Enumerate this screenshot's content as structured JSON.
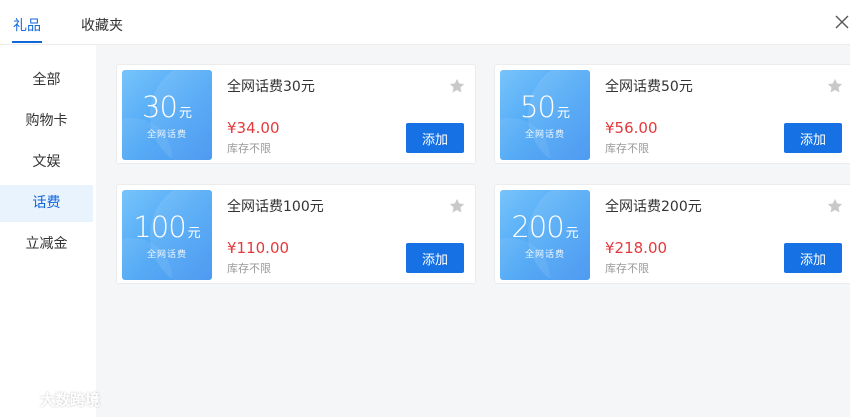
{
  "tabs": [
    {
      "label": "礼品",
      "active": true
    },
    {
      "label": "收藏夹",
      "active": false
    }
  ],
  "colors": {
    "accent": "#1166d8",
    "price": "#e4393c",
    "button": "#1672e4"
  },
  "sidebar": {
    "items": [
      {
        "label": "全部"
      },
      {
        "label": "购物卡"
      },
      {
        "label": "文娱"
      },
      {
        "label": "话费",
        "active": true
      },
      {
        "label": "立减金"
      }
    ]
  },
  "products": [
    {
      "amount": "30",
      "unit": "元",
      "badge": "全网话费",
      "title": "全网话费30元",
      "price": "¥34.00",
      "stock": "库存不限",
      "button": "添加"
    },
    {
      "amount": "50",
      "unit": "元",
      "badge": "全网话费",
      "title": "全网话费50元",
      "price": "¥56.00",
      "stock": "库存不限",
      "button": "添加"
    },
    {
      "amount": "100",
      "unit": "元",
      "badge": "全网话费",
      "title": "全网话费100元",
      "price": "¥110.00",
      "stock": "库存不限",
      "button": "添加"
    },
    {
      "amount": "200",
      "unit": "元",
      "badge": "全网话费",
      "title": "全网话费200元",
      "price": "¥218.00",
      "stock": "库存不限",
      "button": "添加"
    }
  ],
  "icons": {
    "close": "close-icon",
    "favorite": "star-icon"
  },
  "watermark": {
    "text": "大数跨境"
  }
}
